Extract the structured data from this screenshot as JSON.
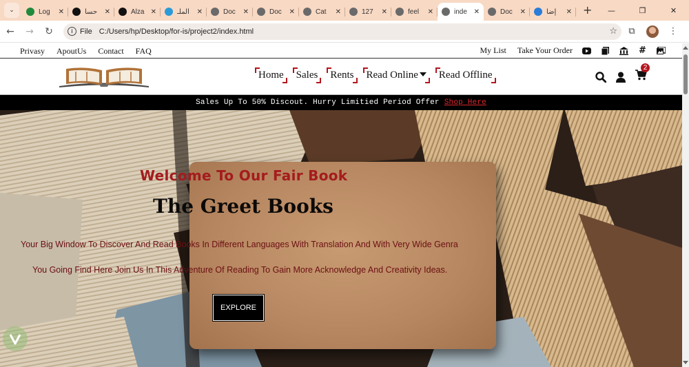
{
  "browser": {
    "tabs": [
      {
        "title": "Log",
        "icon_color": "#1f8a3c"
      },
      {
        "title": "حسا",
        "icon_color": "#111111"
      },
      {
        "title": "Alza",
        "icon_color": "#111111"
      },
      {
        "title": "الملـ",
        "icon_color": "#2a9bd8"
      },
      {
        "title": "Doc",
        "icon_color": "#6a6a6a"
      },
      {
        "title": "Doc",
        "icon_color": "#6a6a6a"
      },
      {
        "title": "Cat",
        "icon_color": "#6a6a6a"
      },
      {
        "title": "127",
        "icon_color": "#6a6a6a"
      },
      {
        "title": "feel",
        "icon_color": "#6a6a6a"
      },
      {
        "title": "inde",
        "icon_color": "#6a6a6a",
        "active": true
      },
      {
        "title": "Doc",
        "icon_color": "#6a6a6a"
      },
      {
        "title": "إضا",
        "icon_color": "#2a7dd8"
      }
    ],
    "address": {
      "chip": "File",
      "url": "C:/Users/hp/Desktop/for-is/project2/index.html"
    }
  },
  "topbar": {
    "left_links": [
      "Privasy",
      "ApoutUs",
      "Contact",
      "FAQ"
    ],
    "right_links": [
      "My List",
      "Take Your Order"
    ],
    "social_icons": [
      "youtube-icon",
      "books-icon",
      "library-icon",
      "hashtag-icon",
      "gallery-icon"
    ]
  },
  "nav": {
    "menu": [
      "Home",
      "Sales",
      "Rents",
      "Read Online",
      "Read Offline"
    ],
    "cart_count": "2"
  },
  "promo": {
    "text": "Sales Up To 50% Discout. Hurry Limitied Period Offer",
    "link": "Shop Here"
  },
  "hero": {
    "subtitle": "Welcome To Our Fair Book",
    "title": "The Greet Books",
    "line1": "Your Big Window To Discover And Read Books In Different Languages With Translation And With Very Wide Genra",
    "line2": "You Going Find Here Join Us In This Adventure Of Reading To Gain More Acknowledge And Creativity Ideas.",
    "button": "EXPLORE"
  },
  "colors": {
    "accent": "#b3151d",
    "heading_red": "#a41c1e",
    "text_maroon": "#6b0f12",
    "tabbar": "#f8d9c4"
  }
}
